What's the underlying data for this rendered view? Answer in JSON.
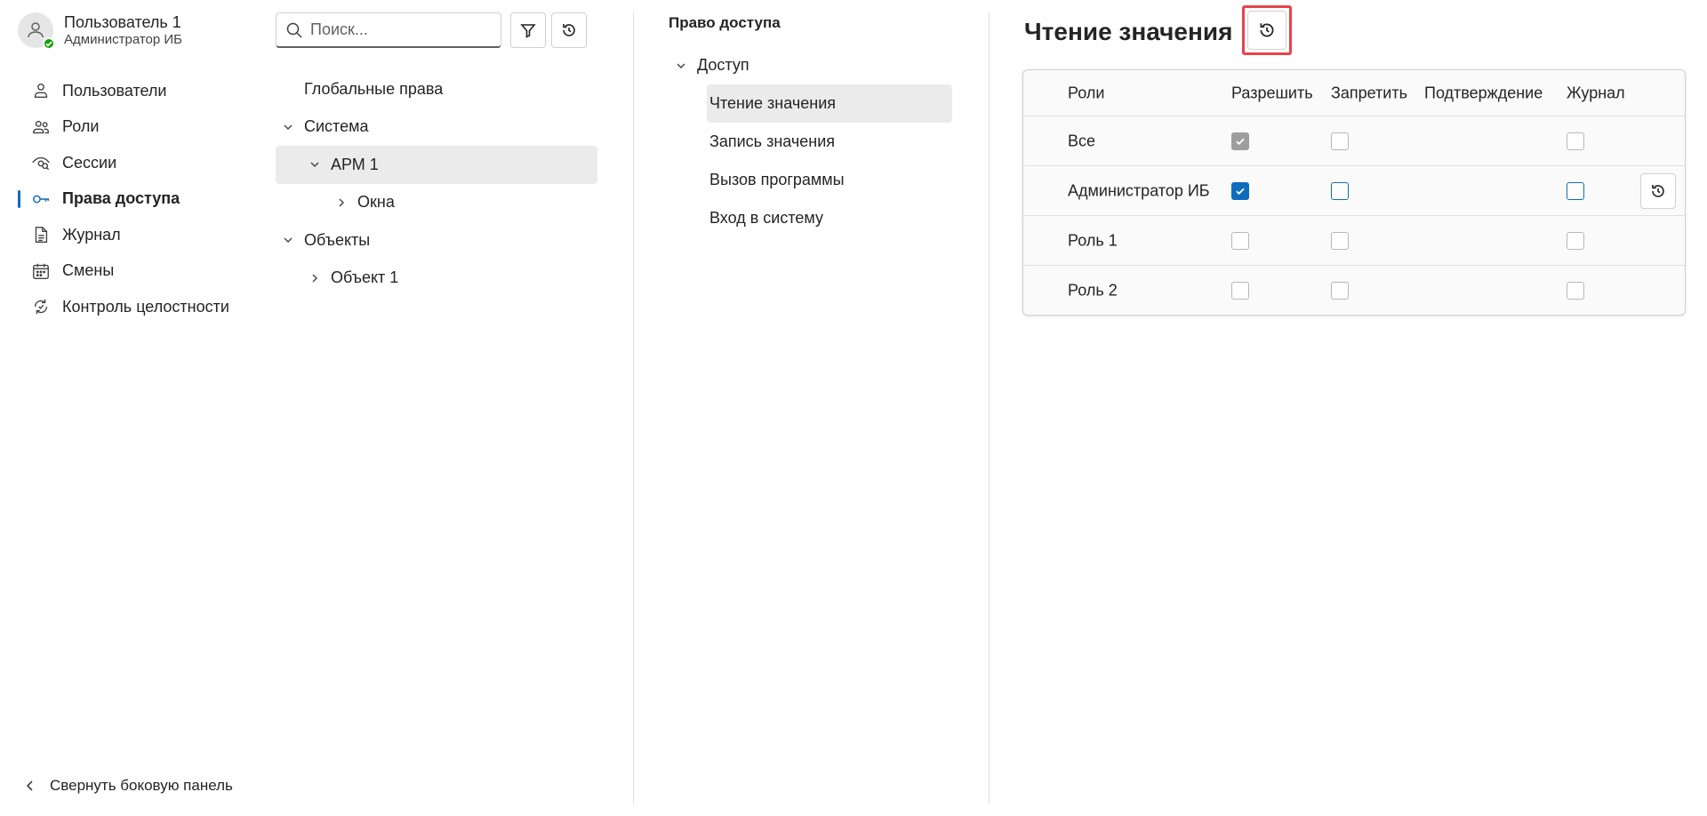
{
  "user": {
    "name": "Пользователь 1",
    "role": "Администратор ИБ",
    "presence_color": "#13a10e"
  },
  "nav": {
    "items": [
      {
        "label": "Пользователи",
        "icon": "person-icon"
      },
      {
        "label": "Роли",
        "icon": "people-icon"
      },
      {
        "label": "Сессии",
        "icon": "eye-tracking-icon"
      },
      {
        "label": "Права доступа",
        "icon": "key-icon",
        "active": true
      },
      {
        "label": "Журнал",
        "icon": "document-icon"
      },
      {
        "label": "Смены",
        "icon": "calendar-icon"
      },
      {
        "label": "Контроль целостности",
        "icon": "arrow-sync-icon"
      }
    ],
    "collapse_label": "Свернуть боковую панель"
  },
  "tree": {
    "search_placeholder": "Поиск...",
    "items": [
      {
        "label": "Глобальные права",
        "level": 0,
        "expander": "none"
      },
      {
        "label": "Система",
        "level": 0,
        "expander": "expanded"
      },
      {
        "label": "АРМ 1",
        "level": 1,
        "expander": "expanded",
        "selected": true
      },
      {
        "label": "Окна",
        "level": 2,
        "expander": "collapsed"
      },
      {
        "label": "Объекты",
        "level": 0,
        "expander": "expanded"
      },
      {
        "label": "Объект 1",
        "level": 1,
        "expander": "collapsed"
      }
    ]
  },
  "rights": {
    "title": "Право доступа",
    "group": "Доступ",
    "items": [
      {
        "label": "Чтение значения",
        "selected": true
      },
      {
        "label": "Запись значения"
      },
      {
        "label": "Вызов программы"
      },
      {
        "label": "Вход в систему"
      }
    ]
  },
  "main": {
    "title": "Чтение значения",
    "highlight_color": "#e8424b",
    "accent_color": "#0f6cbd",
    "columns": {
      "role": "Роли",
      "allow": "Разрешить",
      "deny": "Запретить",
      "confirm": "Подтверждение",
      "log": "Журнал"
    },
    "rows": [
      {
        "role": "Все",
        "allow": true,
        "deny": false,
        "log": false,
        "style": "inherited"
      },
      {
        "role": "Администратор ИБ",
        "allow": true,
        "deny": false,
        "log": false,
        "style": "explicit"
      },
      {
        "role": "Роль 1",
        "allow": false,
        "deny": false,
        "log": false,
        "style": "inherited"
      },
      {
        "role": "Роль 2",
        "allow": false,
        "deny": false,
        "log": false,
        "style": "inherited"
      }
    ]
  }
}
